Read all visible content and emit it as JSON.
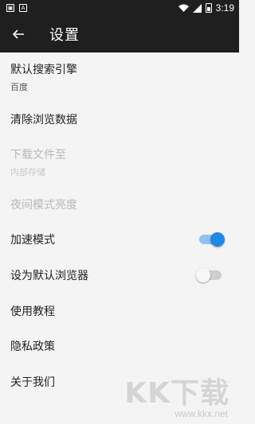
{
  "status_bar": {
    "time": "3:19",
    "icons": [
      "notification-icon",
      "notification-a-icon",
      "wifi-icon",
      "signal-icon",
      "battery-icon"
    ]
  },
  "app_bar": {
    "title": "设置",
    "back_icon": "arrow-left-icon"
  },
  "settings": {
    "default_search": {
      "label": "默认搜索引擎",
      "value": "百度"
    },
    "clear_data": {
      "label": "清除浏览数据"
    },
    "download_location": {
      "label": "下载文件至",
      "value": "内部存储"
    },
    "night_brightness": {
      "label": "夜间模式亮度"
    },
    "accelerate": {
      "label": "加速模式",
      "on": true
    },
    "default_browser": {
      "label": "设为默认浏览器",
      "on": false
    },
    "tutorial": {
      "label": "使用教程"
    },
    "privacy": {
      "label": "隐私政策"
    },
    "about": {
      "label": "关于我们"
    }
  },
  "watermark": {
    "logo": "KK下载",
    "url": "www.kkx.net"
  },
  "colors": {
    "app_bar_bg": "#1f1f1f",
    "page_bg": "#f4f4f4",
    "toggle_on": "#1e88e5",
    "toggle_on_track": "#8ec2f7",
    "toggle_off_track": "#cfcfcf"
  }
}
